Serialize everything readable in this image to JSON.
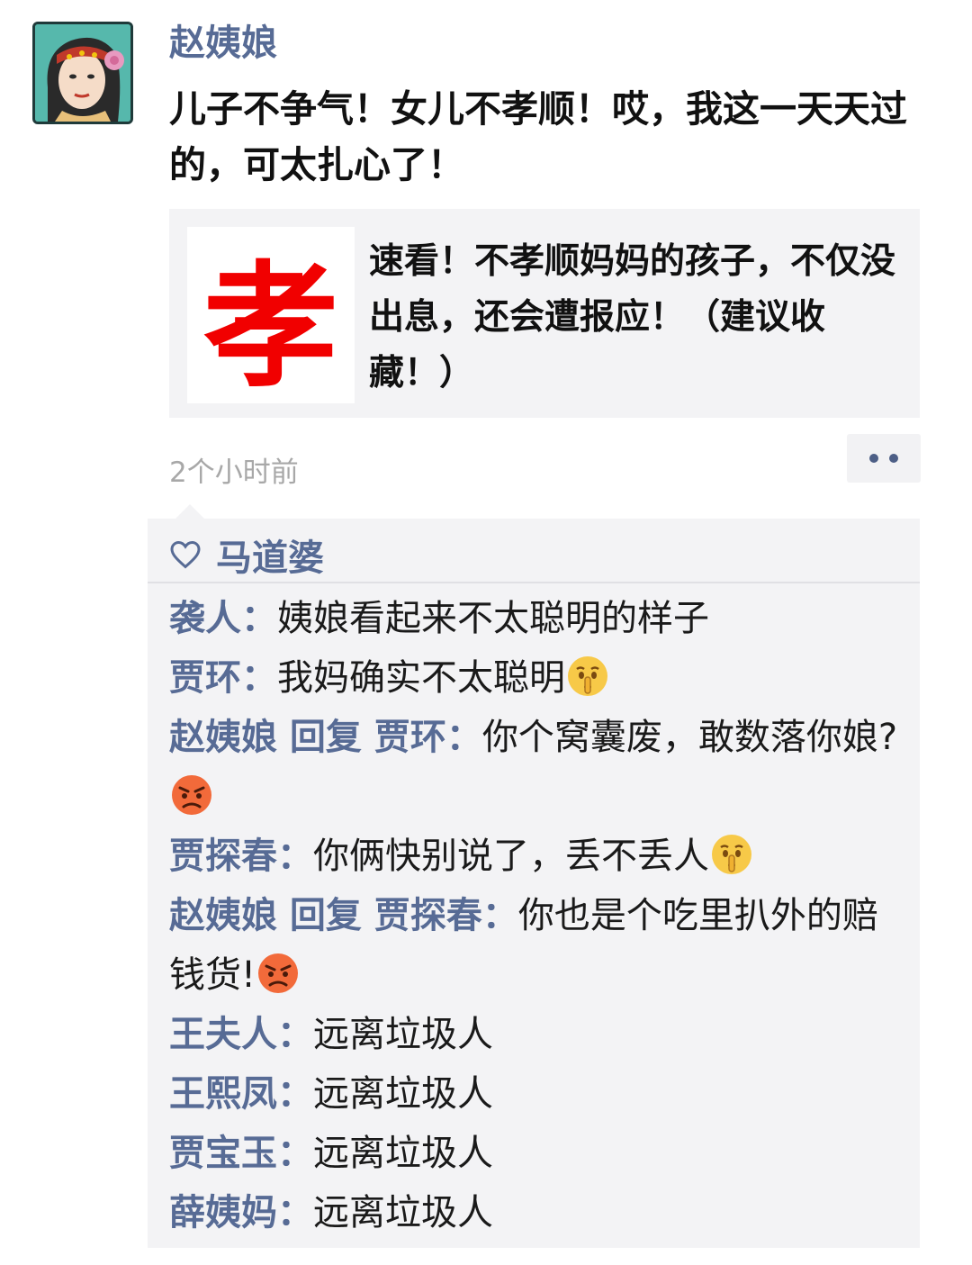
{
  "post": {
    "author": "赵姨娘",
    "text": "儿子不争气！女儿不孝顺！哎，我这一天天过的，可太扎心了！",
    "link_card": {
      "thumb_char": "孝",
      "title": "速看！不孝顺妈妈的孩子，不仅没出息，还会遭报应！（建议收藏！）"
    },
    "timestamp": "2个小时前"
  },
  "likes": {
    "names": "马道婆"
  },
  "reply_word": "回复",
  "comments": [
    {
      "name": "袭人",
      "sep": "：",
      "text": "姨娘看起来不太聪明的样子",
      "emoji": ""
    },
    {
      "name": "贾环",
      "sep": "：",
      "text": "我妈确实不太聪明",
      "emoji": "shush-face-icon"
    },
    {
      "name": "赵姨娘",
      "reply_to": "贾环",
      "sep": "：",
      "text": "你个窝囊废，敢数落你娘?",
      "emoji": "angry-face-icon"
    },
    {
      "name": "贾探春",
      "sep": "：",
      "text": "你俩快别说了，丢不丢人",
      "emoji": "shush-face-icon"
    },
    {
      "name": "赵姨娘",
      "reply_to": "贾探春",
      "sep": "：",
      "text": "你也是个吃里扒外的赔钱货!",
      "emoji": "angry-face-icon"
    },
    {
      "name": "王夫人",
      "sep": "：",
      "text": "远离垃圾人",
      "emoji": ""
    },
    {
      "name": "王熙凤",
      "sep": "：",
      "text": "远离垃圾人",
      "emoji": ""
    },
    {
      "name": "贾宝玉",
      "sep": "：",
      "text": "远离垃圾人",
      "emoji": ""
    },
    {
      "name": "薛姨妈",
      "sep": "：",
      "text": "远离垃圾人",
      "emoji": ""
    }
  ],
  "colors": {
    "name_link": "#576b95",
    "card_bg": "#f3f3f5",
    "thumb_char": "#f10000",
    "timestamp": "#a8a8a8"
  }
}
